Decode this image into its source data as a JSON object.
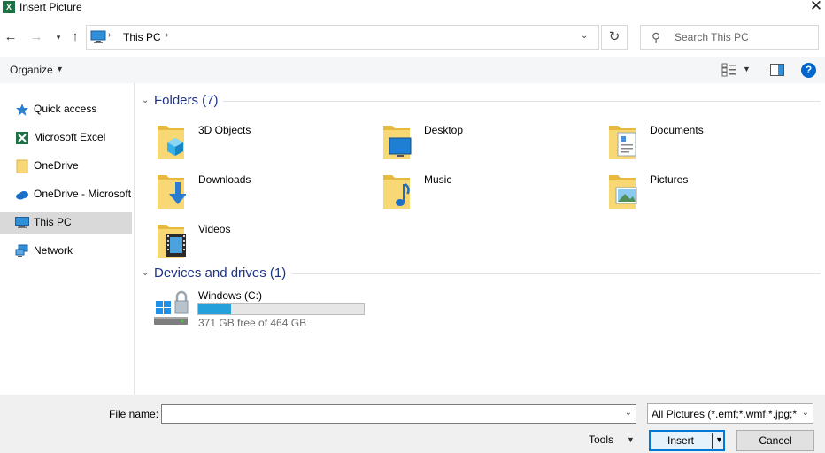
{
  "window": {
    "title": "Insert Picture",
    "close_glyph": "✕",
    "app_icon_letter": "X"
  },
  "address": {
    "location": "This PC",
    "search_placeholder": "Search This PC"
  },
  "command_bar": {
    "organize_label": "Organize"
  },
  "nav": {
    "items": [
      {
        "label": "Quick access",
        "icon": "star-icon",
        "selected": false
      },
      {
        "label": "Microsoft Excel",
        "icon": "excel-icon",
        "selected": false
      },
      {
        "label": "OneDrive",
        "icon": "folder-icon",
        "selected": false
      },
      {
        "label": "OneDrive - Microsoft",
        "icon": "cloud-icon",
        "selected": false
      },
      {
        "label": "This PC",
        "icon": "computer-icon",
        "selected": true
      },
      {
        "label": "Network",
        "icon": "network-icon",
        "selected": false
      }
    ]
  },
  "folders": {
    "heading": "Folders (7)",
    "items": [
      {
        "label": "3D Objects",
        "icon": "3d-objects-folder-icon"
      },
      {
        "label": "Desktop",
        "icon": "desktop-folder-icon"
      },
      {
        "label": "Documents",
        "icon": "documents-folder-icon"
      },
      {
        "label": "Downloads",
        "icon": "downloads-folder-icon"
      },
      {
        "label": "Music",
        "icon": "music-folder-icon"
      },
      {
        "label": "Pictures",
        "icon": "pictures-folder-icon"
      },
      {
        "label": "Videos",
        "icon": "videos-folder-icon"
      }
    ]
  },
  "devices": {
    "heading": "Devices and drives (1)",
    "drives": [
      {
        "name": "Windows (C:)",
        "free_text": "371 GB free of 464 GB",
        "used_fraction": 0.2
      }
    ]
  },
  "footer": {
    "file_name_label": "File name:",
    "file_name_value": "",
    "filter_value": "All Pictures (*.emf;*.wmf;*.jpg;*",
    "tools_label": "Tools",
    "insert_label": "Insert",
    "cancel_label": "Cancel"
  },
  "colors": {
    "accent": "#0078d7",
    "heading": "#1e3287",
    "drive_fill": "#26a0da",
    "folder": "#f8d775"
  }
}
